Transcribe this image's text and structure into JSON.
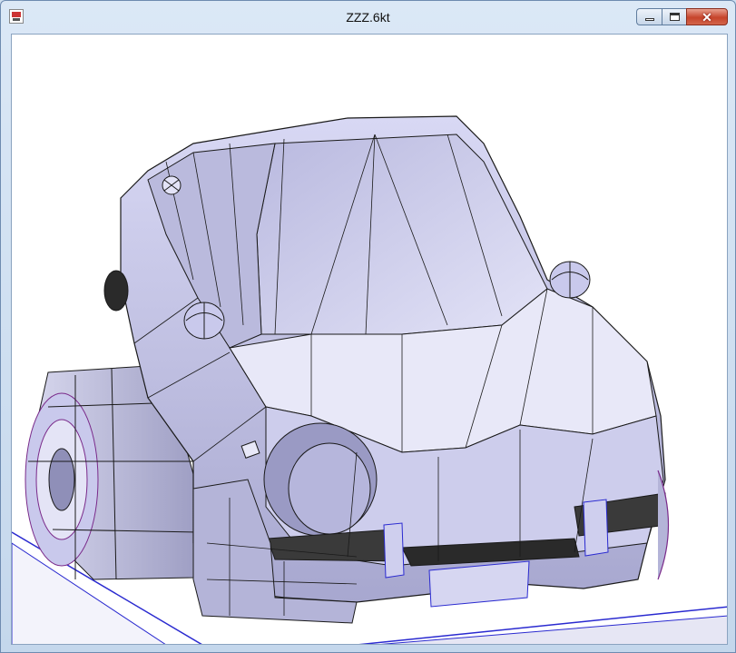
{
  "window": {
    "title": "ZZZ.6kt",
    "app_icon": "app-icon",
    "controls": {
      "minimize_icon": "minimize-icon",
      "maximize_icon": "maximize-icon",
      "close_icon": "close-icon",
      "close_glyph": "✕"
    }
  },
  "scene": {
    "model": "car-wireframe-model",
    "render_style": "flat-shaded wireframe",
    "colors": {
      "body_fill": "#c9c9ec",
      "body_dark": "#8f8fb8",
      "edge": "#1a1a1a",
      "ground_line": "#2a2ad0",
      "tire_edge": "#7a2a8a",
      "background": "#ffffff"
    }
  }
}
